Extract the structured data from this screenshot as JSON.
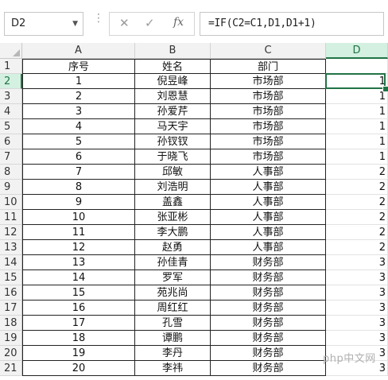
{
  "name_box": {
    "value": "D2"
  },
  "formula_bar": {
    "cancel_icon": "✕",
    "enter_icon": "✓",
    "fx_label": "fx",
    "formula": "=IF(C2=C1,D1,D1+1)"
  },
  "columns": [
    "A",
    "B",
    "C",
    "D"
  ],
  "selected_column": "D",
  "selected_row": 2,
  "rows": [
    {
      "num": "1",
      "a": "序号",
      "b": "姓名",
      "c": "部门",
      "d": ""
    },
    {
      "num": "2",
      "a": "1",
      "b": "倪昱峰",
      "c": "市场部",
      "d": "1"
    },
    {
      "num": "3",
      "a": "2",
      "b": "刘恩慧",
      "c": "市场部",
      "d": "1"
    },
    {
      "num": "4",
      "a": "3",
      "b": "孙爱芹",
      "c": "市场部",
      "d": "1"
    },
    {
      "num": "5",
      "a": "4",
      "b": "马天宇",
      "c": "市场部",
      "d": "1"
    },
    {
      "num": "6",
      "a": "5",
      "b": "孙钗钗",
      "c": "市场部",
      "d": "1"
    },
    {
      "num": "7",
      "a": "6",
      "b": "于晓飞",
      "c": "市场部",
      "d": "1"
    },
    {
      "num": "8",
      "a": "7",
      "b": "邱敏",
      "c": "人事部",
      "d": "2"
    },
    {
      "num": "9",
      "a": "8",
      "b": "刘浩明",
      "c": "人事部",
      "d": "2"
    },
    {
      "num": "10",
      "a": "9",
      "b": "盖鑫",
      "c": "人事部",
      "d": "2"
    },
    {
      "num": "11",
      "a": "10",
      "b": "张亚彬",
      "c": "人事部",
      "d": "2"
    },
    {
      "num": "12",
      "a": "11",
      "b": "李大鹏",
      "c": "人事部",
      "d": "2"
    },
    {
      "num": "13",
      "a": "12",
      "b": "赵勇",
      "c": "人事部",
      "d": "2"
    },
    {
      "num": "14",
      "a": "13",
      "b": "孙佳青",
      "c": "财务部",
      "d": "3"
    },
    {
      "num": "15",
      "a": "14",
      "b": "罗军",
      "c": "财务部",
      "d": "3"
    },
    {
      "num": "16",
      "a": "15",
      "b": "苑兆尚",
      "c": "财务部",
      "d": "3"
    },
    {
      "num": "17",
      "a": "16",
      "b": "周红红",
      "c": "财务部",
      "d": "3"
    },
    {
      "num": "18",
      "a": "17",
      "b": "孔雪",
      "c": "财务部",
      "d": "3"
    },
    {
      "num": "19",
      "a": "18",
      "b": "谭鹏",
      "c": "财务部",
      "d": "3"
    },
    {
      "num": "20",
      "a": "19",
      "b": "李丹",
      "c": "财务部",
      "d": "3"
    },
    {
      "num": "21",
      "a": "20",
      "b": "李祎",
      "c": "财务部",
      "d": "3"
    }
  ],
  "watermark": "php中文网",
  "colors": {
    "accent": "#217346",
    "header_selected": "#d3f0e0"
  }
}
